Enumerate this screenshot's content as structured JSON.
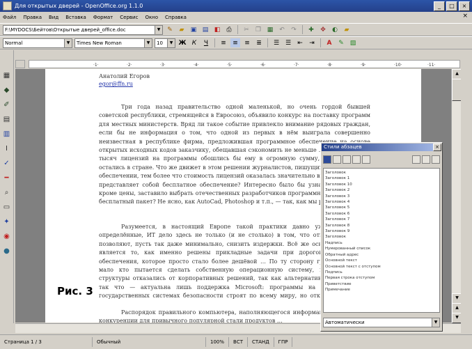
{
  "window": {
    "title": "Для открытых дверей - OpenOffice.org 1.1.0"
  },
  "menu": {
    "items": [
      "Файл",
      "Правка",
      "Вид",
      "Вставка",
      "Формат",
      "Сервис",
      "Окно",
      "Справка"
    ]
  },
  "toolbar": {
    "path": "F:\\MYDOCS\\Бейтов\\Открытые дверей_office.doc"
  },
  "format": {
    "style": "Normal",
    "font": "Times New Roman",
    "size": "10"
  },
  "document": {
    "author_name": "Анатолий Егоров",
    "author_email": "egor@ffn.ru",
    "p1": "Три года назад правительство одной маленькой, но очень гордой бывшей советской республики, стремящейся в Евросоюз, объявило конкурс на поставку программ для местных министерств. Вряд ли такое событие привлекло внимание рядовых граждан, если бы не информация о том, что одной из первых в нём выиграла совершенно неизвестная в республике фирма, предложившая программное обеспечение на основе открытых исходных кодов заказчику, обещавшая сэкономить не меньше … Более четырёх тысяч лицензий на программы обошлись бы ему в огромную сумму, а здесь деньги остались в стране. Что же движет в этом решении журналистов, пишущих о программном обеспечении, тем более что стоимость лицензий оказалась значительно выше? Так что же представляет собой бесплатное обеспечение? Интересно было бы узнать, что именно, кроме цены, заставило выбрать отечественных разработчиков программного обеспечения бесплатный пакет? Не ясно, как AutoCad, Photoshop и т.п., — так, как мы решили наш …",
    "p2": "Разумеется, в настоящий Европе такой практики давно уже нет, однако определённые, ИТ дело здесь не только (и не столько) в том, что открытые системы позволяют, пусть так даже минимально, снизить издержки. Всё же основной разницей является то, как именно решены прикладные задачи при дорогой программного обеспечения, которое просто стало более дешёвой … По ту сторону границы впрочем мало кто пытается сделать собственную операционную систему, государственные структуры отказались от корпоративных решений, так как альтернативные решения Т, так что — актуальна лишь поддержка Microsoft: программы на весь мир. А в государственных системах безопасности строят по всему миру, но открытые исходные коды сами по себе не являются гарантией. Поэтому от дорогих продуктов, заполнявших всё и вся, и перейти к использованию открытых исходных кодов.",
    "p3": "Распорядок правильного компьютера, наполняющегося информацией, настоящей конкуренции для привычного популярной стали продуктов …",
    "figure_label": "Рис. 3"
  },
  "stylist": {
    "title": "Стили абзацев",
    "close": "×",
    "items": [
      "Заголовок",
      "Заголовок 1",
      "Заголовок 10",
      "Заголовок 2",
      "Заголовок 3",
      "Заголовок 4",
      "Заголовок 5",
      "Заголовок 6",
      "Заголовок 7",
      "Заголовок 8",
      "Заголовок 9",
      "Заголовок",
      "Надпись",
      "Нумерованный список",
      "Обратный адрес",
      "Основной текст",
      "Основной текст с отступом",
      "Подпись",
      "Первая строка отступом",
      "Приветствие",
      "Примечание"
    ],
    "filter": "Автоматически"
  },
  "status": {
    "page": "Страница 1 / 3",
    "style": "Обычный",
    "zoom": "100%",
    "mode": "ВСТ",
    "std": "СТАНД",
    "hyp": "ГПР"
  },
  "colors": {
    "titlebar": "#24408a",
    "chrome": "#d4d0c8",
    "link": "#2233aa"
  }
}
